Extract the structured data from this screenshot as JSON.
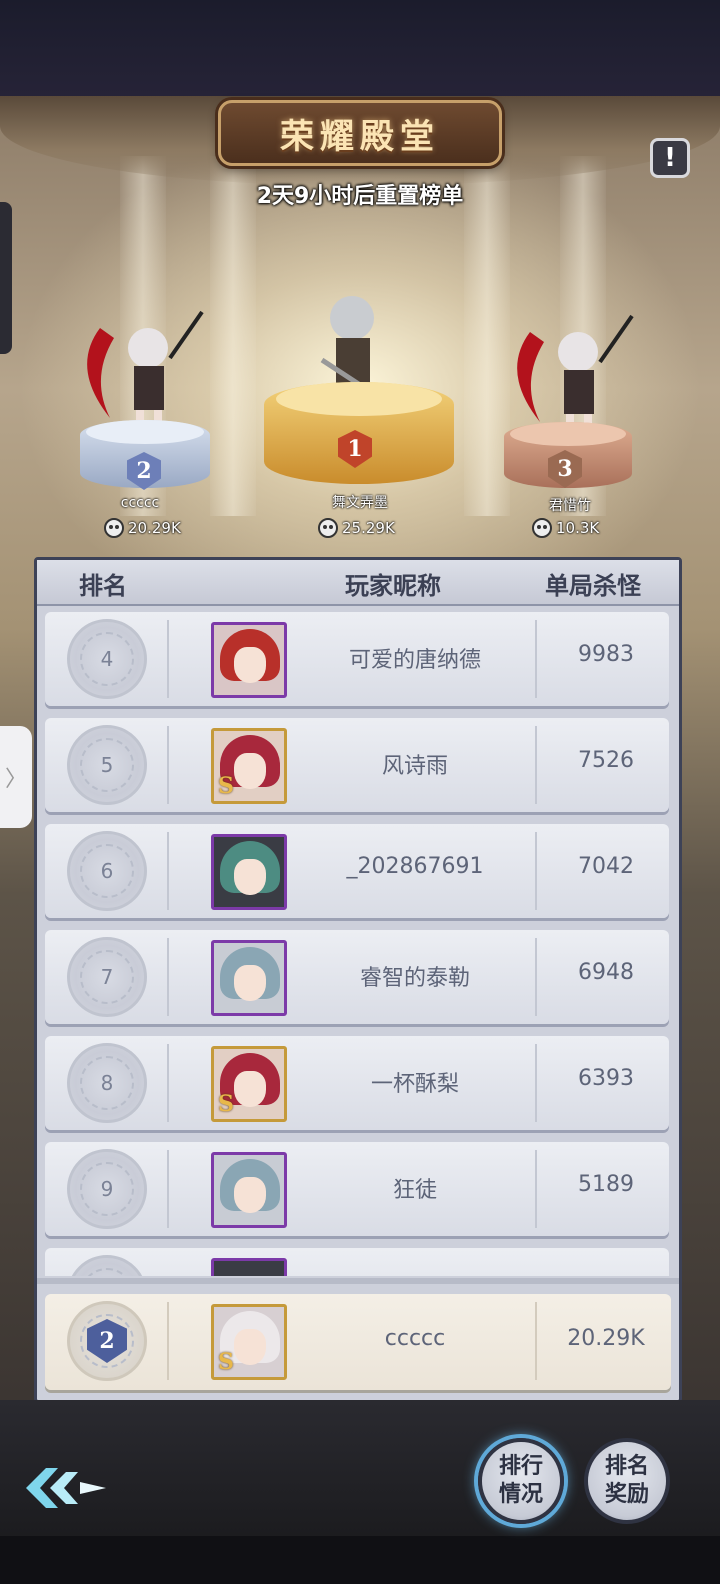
{
  "header": {
    "title": "荣耀殿堂",
    "reset_notice": "2天9小时后重置榜单",
    "info_label": "!"
  },
  "podium": [
    {
      "rank": "2",
      "name": "ccccc",
      "score": "20.29K"
    },
    {
      "rank": "1",
      "name": "舞文弄墨",
      "score": "25.29K"
    },
    {
      "rank": "3",
      "name": "君惜竹",
      "score": "10.3K"
    }
  ],
  "table": {
    "columns": [
      "排名",
      "玩家昵称",
      "单局杀怪"
    ],
    "rows": [
      {
        "rank": "4",
        "nickname": "可爱的唐纳德",
        "kills": "9983",
        "frame": "purple",
        "hair": "#b8302a"
      },
      {
        "rank": "5",
        "nickname": "风诗雨",
        "kills": "7526",
        "frame": "gold",
        "hair": "#a8283c"
      },
      {
        "rank": "6",
        "nickname": "_202867691",
        "kills": "7042",
        "frame": "purple",
        "hair": "#4d8c82"
      },
      {
        "rank": "7",
        "nickname": "睿智的泰勒",
        "kills": "6948",
        "frame": "purple",
        "hair": "#8aa6b4"
      },
      {
        "rank": "8",
        "nickname": "一杯酥梨",
        "kills": "6393",
        "frame": "gold",
        "hair": "#a8283c"
      },
      {
        "rank": "9",
        "nickname": "狂徒",
        "kills": "5189",
        "frame": "purple",
        "hair": "#8aa6b4"
      }
    ],
    "self": {
      "rank": "2",
      "nickname": "ccccc",
      "kills": "20.29K"
    }
  },
  "buttons": {
    "ranking_status": "排行情况",
    "ranking_rewards": "排名奖励"
  },
  "colors": {
    "gold": "#e3b44d",
    "silver": "#b9c6dc",
    "bronze": "#c48a6a",
    "frame_purple": "#7c3aa8",
    "frame_gold": "#c59a3a"
  }
}
